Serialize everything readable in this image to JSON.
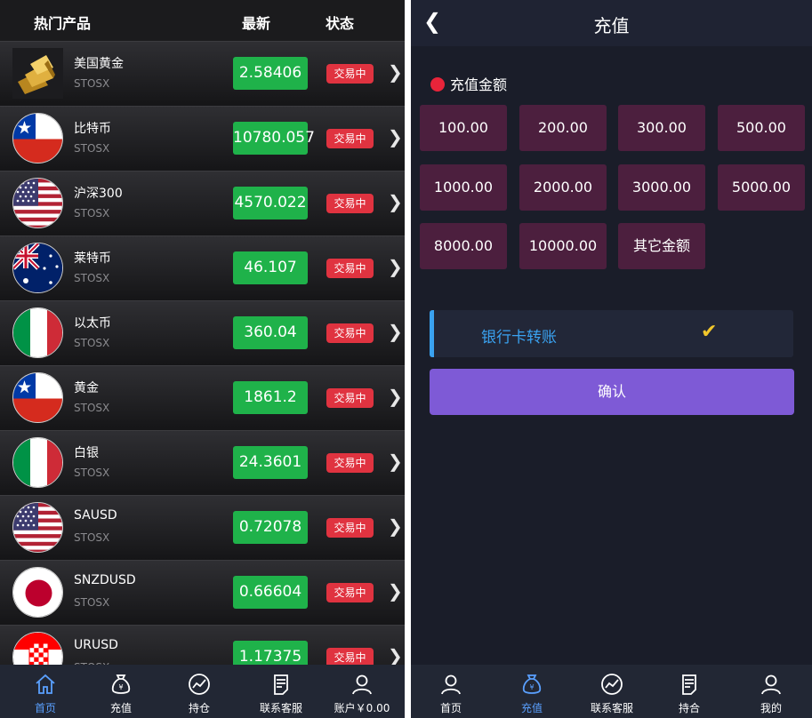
{
  "left": {
    "header": {
      "col_product": "热门产品",
      "col_latest": "最新",
      "col_status": "状态"
    },
    "products": [
      {
        "name": "美国黄金",
        "code": "STOSX",
        "price": "2.58406",
        "status": "交易中",
        "flag": "gold-bars-icon"
      },
      {
        "name": "比特币",
        "code": "STOSX",
        "price": "10780.057",
        "status": "交易中",
        "flag": "chile-flag-icon"
      },
      {
        "name": "沪深300",
        "code": "STOSX",
        "price": "4570.022",
        "status": "交易中",
        "flag": "usa-flag-icon"
      },
      {
        "name": "莱特币",
        "code": "STOSX",
        "price": "46.107",
        "status": "交易中",
        "flag": "australia-flag-icon"
      },
      {
        "name": "以太币",
        "code": "STOSX",
        "price": "360.04",
        "status": "交易中",
        "flag": "italy-flag-icon"
      },
      {
        "name": "黄金",
        "code": "STOSX",
        "price": "1861.2",
        "status": "交易中",
        "flag": "chile-flag-icon"
      },
      {
        "name": "白银",
        "code": "STOSX",
        "price": "24.3601",
        "status": "交易中",
        "flag": "italy-flag-icon"
      },
      {
        "name": "SAUSD",
        "code": "STOSX",
        "price": "0.72078",
        "status": "交易中",
        "flag": "usa-flag-icon"
      },
      {
        "name": "SNZDUSD",
        "code": "STOSX",
        "price": "0.66604",
        "status": "交易中",
        "flag": "japan-flag-icon"
      },
      {
        "name": "URUSD",
        "code": "STOSX",
        "price": "1.17375",
        "status": "交易中",
        "flag": "croatia-flag-icon"
      }
    ],
    "tabs": [
      {
        "label": "首页",
        "icon": "home-icon",
        "active": true
      },
      {
        "label": "充值",
        "icon": "money-bag-icon",
        "active": false
      },
      {
        "label": "持仓",
        "icon": "chart-icon",
        "active": false
      },
      {
        "label": "联系客服",
        "icon": "document-icon",
        "active": false
      },
      {
        "label": "账户￥0.00",
        "icon": "user-icon",
        "active": false
      }
    ]
  },
  "right": {
    "title": "充值",
    "section_label": "充值金额",
    "amounts": [
      "100.00",
      "200.00",
      "300.00",
      "500.00",
      "1000.00",
      "2000.00",
      "3000.00",
      "5000.00",
      "8000.00",
      "10000.00",
      "其它金额"
    ],
    "method_label": "银行卡转账",
    "confirm_label": "确认",
    "tabs": [
      {
        "label": "首页",
        "icon": "user-icon",
        "active": false
      },
      {
        "label": "充值",
        "icon": "money-bag-icon",
        "active": true
      },
      {
        "label": "联系客服",
        "icon": "chart-icon",
        "active": false
      },
      {
        "label": "持合",
        "icon": "document-icon",
        "active": false
      },
      {
        "label": "我的",
        "icon": "user-icon",
        "active": false
      }
    ]
  },
  "colors": {
    "price_green": "#1fb24a",
    "badge_red": "#e03340",
    "accent_blue": "#3aa2f0",
    "confirm_purple": "#7e5ad6",
    "amount_bg": "#4c1f3e"
  }
}
